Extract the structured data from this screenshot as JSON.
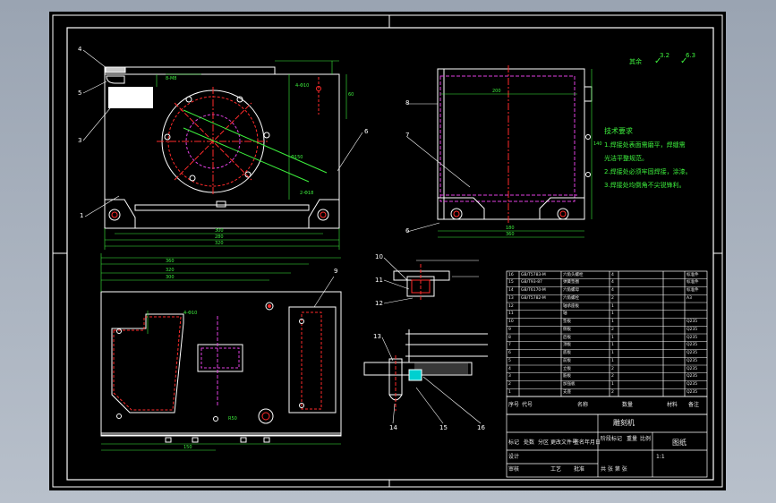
{
  "roughness": {
    "label": "其余",
    "mark_a": "3.2",
    "mark_b": "6.3"
  },
  "tech_req": {
    "title": "技术要求",
    "lines": [
      "1.焊接处表面需磨平，焊缝需",
      "  光洁平整规范。",
      "2.焊接处必须牢固焊接，涂漆。",
      "3.焊接处均倒角不尖锐锋利。"
    ]
  },
  "view1": {
    "leaders": [
      "4",
      "5",
      "3",
      "6",
      "1"
    ]
  },
  "view2": {
    "leaders": [
      "8",
      "7",
      "6"
    ]
  },
  "section": {
    "leaders": [
      "9",
      "10",
      "11",
      "12",
      "13",
      "14",
      "15",
      "16"
    ]
  },
  "title_block": {
    "part_name": "雕刻机",
    "company": "图纸",
    "headers": [
      "序号",
      "代号",
      "名称",
      "数量",
      "材料",
      "备注"
    ],
    "rows": [
      [
        "16",
        "GB/T5783-M",
        "六角头螺栓",
        "4",
        "",
        "标准件"
      ],
      [
        "15",
        "GB/T93-87",
        "弹簧垫圈",
        "4",
        "",
        "标准件"
      ],
      [
        "14",
        "GB/T6170-M",
        "六角螺母",
        "4",
        "",
        "标准件"
      ],
      [
        "13",
        "GB/T5782-M",
        "六角螺栓",
        "2",
        "",
        "A3"
      ],
      [
        "12",
        "",
        "轴承座板",
        "1",
        "",
        ""
      ],
      [
        "11",
        "",
        "轴",
        "1",
        "",
        ""
      ],
      [
        "10",
        "",
        "垫板",
        "1",
        "",
        "Q235"
      ],
      [
        "9",
        "",
        "侧板",
        "2",
        "",
        "Q235"
      ],
      [
        "8",
        "",
        "后板",
        "1",
        "",
        "Q235"
      ],
      [
        "7",
        "",
        "顶板",
        "1",
        "",
        "Q235"
      ],
      [
        "6",
        "",
        "底板",
        "1",
        "",
        "Q235"
      ],
      [
        "5",
        "",
        "前板",
        "1",
        "",
        "Q235"
      ],
      [
        "4",
        "",
        "立板",
        "2",
        "",
        "Q235"
      ],
      [
        "3",
        "",
        "筋板",
        "2",
        "",
        "Q235"
      ],
      [
        "2",
        "",
        "加强板",
        "1",
        "",
        "Q235"
      ],
      [
        "1",
        "",
        "支座",
        "2",
        "",
        "Q235"
      ]
    ],
    "sign_labels": [
      "标记",
      "处数",
      "分区",
      "更改文件号",
      "签名",
      "年月日"
    ],
    "roles": [
      "设计",
      "审核",
      "工艺",
      "批准"
    ],
    "stage_labels": [
      "阶段标记",
      "重量",
      "比例"
    ],
    "scale": "1:1",
    "sheet_info": "共  张  第  张"
  },
  "dims": {
    "d1": "280",
    "d2": "300",
    "d3": "320",
    "d4": "360",
    "d5": "150",
    "d6": "140",
    "d7": "180",
    "d8": "200",
    "d9": "60",
    "d10": "8-M8",
    "d11": "Φ150",
    "d12": "4-Φ10",
    "d13": "2-Φ18",
    "d14": "R50"
  }
}
